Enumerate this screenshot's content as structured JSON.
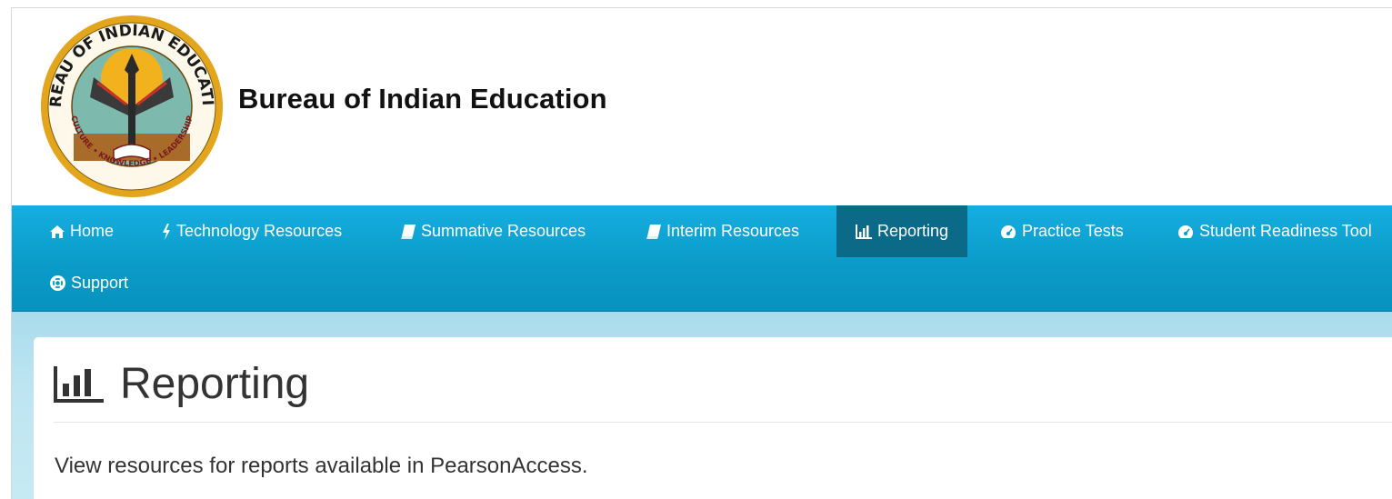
{
  "header": {
    "site_title": "Bureau of Indian Education",
    "logo": {
      "ring_text_top": "BUREAU OF INDIAN EDUCATION",
      "ring_text_bottom": "CULTURE • KNOWLEDGE • LEADERSHIP"
    }
  },
  "nav": {
    "items": [
      {
        "label": "Home",
        "icon": "home-icon"
      },
      {
        "label": "Technology Resources",
        "icon": "bolt-icon"
      },
      {
        "label": "Summative Resources",
        "icon": "book-icon"
      },
      {
        "label": "Interim Resources",
        "icon": "book-icon"
      },
      {
        "label": "Reporting",
        "icon": "bar-chart-icon",
        "active": true
      },
      {
        "label": "Practice Tests",
        "icon": "dashboard-icon"
      },
      {
        "label": "Student Readiness Tool",
        "icon": "dashboard-icon"
      },
      {
        "label": "Support",
        "icon": "life-ring-icon"
      }
    ]
  },
  "main": {
    "title": "Reporting",
    "title_icon": "bar-chart-icon",
    "lead": "View resources for reports available in PearsonAccess."
  },
  "colors": {
    "nav_background": "#0a9ac7",
    "nav_active": "#0a6a88",
    "content_background": "#bde5f1",
    "logo_ring": "#e3a51c"
  }
}
